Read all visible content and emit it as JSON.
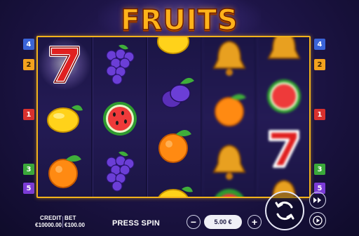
{
  "game": {
    "title": "FRUITS"
  },
  "paylines": {
    "left": [
      {
        "num": "4",
        "color": "#3a64d8"
      },
      {
        "num": "2",
        "color": "#f4a21e"
      },
      {
        "num": "1",
        "color": "#d9312e"
      },
      {
        "num": "3",
        "color": "#3aa83a"
      },
      {
        "num": "5",
        "color": "#7b3bd6"
      }
    ],
    "right": [
      {
        "num": "4",
        "color": "#3a64d8"
      },
      {
        "num": "2",
        "color": "#f4a21e"
      },
      {
        "num": "1",
        "color": "#d9312e"
      },
      {
        "num": "3",
        "color": "#3aa83a"
      },
      {
        "num": "5",
        "color": "#7b3bd6"
      }
    ]
  },
  "reels": [
    [
      "seven-icon",
      "lemon-icon",
      "orange-icon"
    ],
    [
      "grapes-icon",
      "watermelon-icon",
      "grapes-icon"
    ],
    [
      "lemon-icon",
      "plum-icon",
      "orange-icon",
      "lemon-icon"
    ],
    [
      "bell-icon",
      "orange-icon",
      "bell-icon",
      "watermelon-icon"
    ],
    [
      "bell-icon",
      "watermelon-icon",
      "seven-icon",
      "bell-icon"
    ]
  ],
  "footer": {
    "credit_label": "CREDIT",
    "credit_value": "€10000.00",
    "bet_label": "BET",
    "bet_value": "€100.00",
    "press_spin": "PRESS SPIN",
    "bet_amount": "5.00 €",
    "minus": "−",
    "plus": "+"
  },
  "colors": {
    "frame": "#f2b21b",
    "title": "#ffb21a",
    "background": "#1e1548"
  }
}
